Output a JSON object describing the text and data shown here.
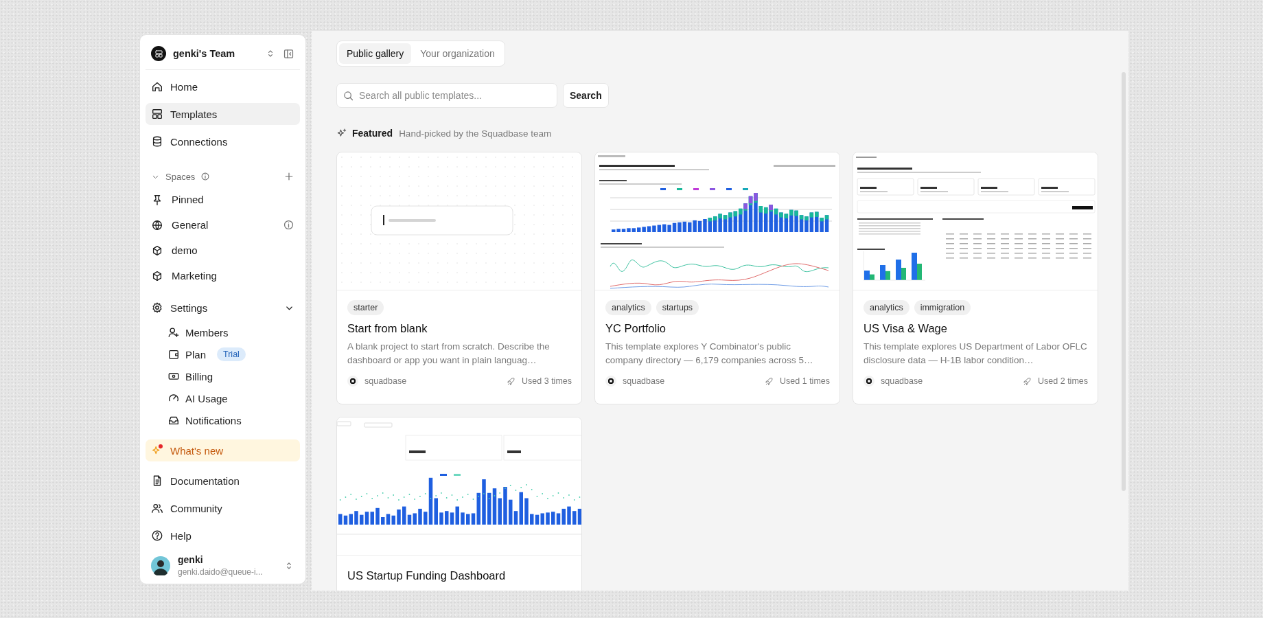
{
  "sidebar": {
    "team": {
      "name": "genki's Team"
    },
    "nav": [
      {
        "label": "Home",
        "selected": false
      },
      {
        "label": "Templates",
        "selected": true
      },
      {
        "label": "Connections",
        "selected": false
      }
    ],
    "spaces": {
      "label": "Spaces",
      "expanded": true,
      "items": [
        {
          "label": "Pinned",
          "info": false
        },
        {
          "label": "General",
          "info": true
        },
        {
          "label": "demo",
          "info": false
        },
        {
          "label": "Marketing",
          "info": false
        }
      ]
    },
    "settings": {
      "label": "Settings",
      "expanded": true,
      "children": [
        {
          "label": "Members"
        },
        {
          "label": "Plan",
          "badge": "Trial"
        },
        {
          "label": "Billing"
        },
        {
          "label": "AI Usage"
        },
        {
          "label": "Notifications"
        }
      ]
    },
    "whats_new": {
      "label": "What's new",
      "unread": true
    },
    "links": [
      {
        "label": "Documentation"
      },
      {
        "label": "Community"
      },
      {
        "label": "Help"
      }
    ],
    "user": {
      "name": "genki",
      "email": "genki.daido@queue-i..."
    }
  },
  "tabs": [
    {
      "label": "Public gallery",
      "selected": true
    },
    {
      "label": "Your organization",
      "selected": false
    }
  ],
  "search": {
    "placeholder": "Search all public templates...",
    "button": "Search"
  },
  "featured": {
    "title": "Featured",
    "subtitle": "Hand-picked by the Squadbase team"
  },
  "templates": [
    {
      "preview": {
        "kind": "blank"
      },
      "tags": [
        "starter"
      ],
      "title": "Start from blank",
      "description": "A blank project to start from scratch. Describe the dashboard or app you want in plain languag…",
      "author": "squadbase",
      "uses": "Used 3 times"
    },
    {
      "preview": {
        "kind": "bar-line"
      },
      "tags": [
        "analytics",
        "startups"
      ],
      "title": "YC Portfolio",
      "description": "This template explores Y Combinator's public company directory — 6,179 companies across 5…",
      "author": "squadbase",
      "uses": "Used 1 times"
    },
    {
      "preview": {
        "kind": "table"
      },
      "tags": [
        "analytics",
        "immigration"
      ],
      "title": "US Visa & Wage",
      "description": "This template explores US Department of Labor OFLC disclosure data — H-1B labor condition…",
      "author": "squadbase",
      "uses": "Used 2 times"
    },
    {
      "preview": {
        "kind": "bar-scatter"
      },
      "title": "US Startup Funding Dashboard"
    }
  ]
}
